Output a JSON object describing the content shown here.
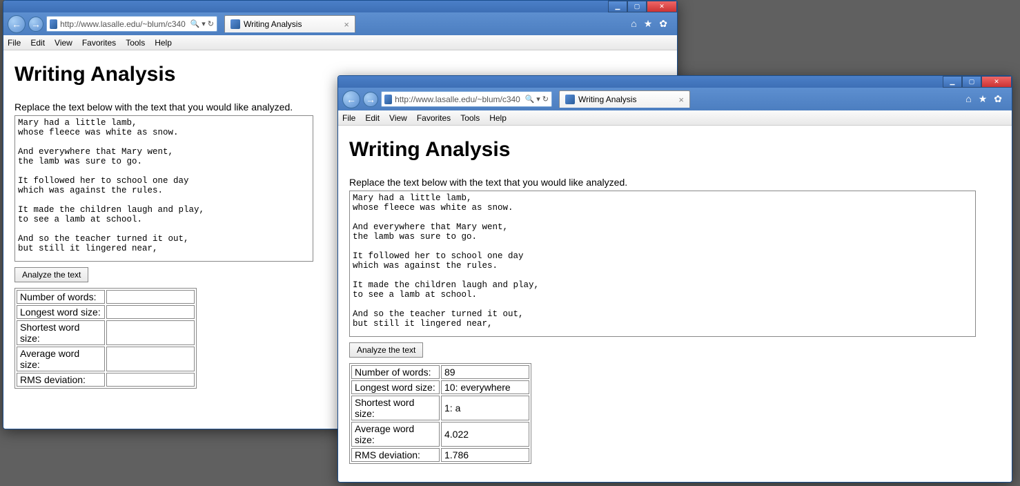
{
  "url": "http://www.lasalle.edu/~blum/c340",
  "tab_title": "Writing Analysis",
  "menu": [
    "File",
    "Edit",
    "View",
    "Favorites",
    "Tools",
    "Help"
  ],
  "page": {
    "heading": "Writing Analysis",
    "instruction": "Replace the text below with the text that you would like analyzed.",
    "sample_text": "Mary had a little lamb,\nwhose fleece was white as snow.\n\nAnd everywhere that Mary went,\nthe lamb was sure to go.\n\nIt followed her to school one day\nwhich was against the rules.\n\nIt made the children laugh and play,\nto see a lamb at school.\n\nAnd so the teacher turned it out,\nbut still it lingered near,",
    "button_label": "Analyze the text"
  },
  "rows": [
    {
      "label": "Number of words:",
      "value": "89"
    },
    {
      "label": "Longest word size:",
      "value": "10: everywhere"
    },
    {
      "label": "Shortest word size:",
      "value": "1: a"
    },
    {
      "label": "Average word size:",
      "value": "4.022"
    },
    {
      "label": "RMS deviation:",
      "value": "1.786"
    }
  ],
  "empty_values": [
    "",
    "",
    "",
    "",
    ""
  ],
  "icons": {
    "home": "⌂",
    "star": "★",
    "gear": "✿",
    "search": "🔍",
    "dropdown": "▾",
    "refresh": "↻",
    "back": "←",
    "forward": "→",
    "close_tab": "×",
    "minimize": "▁",
    "maximize": "▢",
    "close": "✕"
  }
}
